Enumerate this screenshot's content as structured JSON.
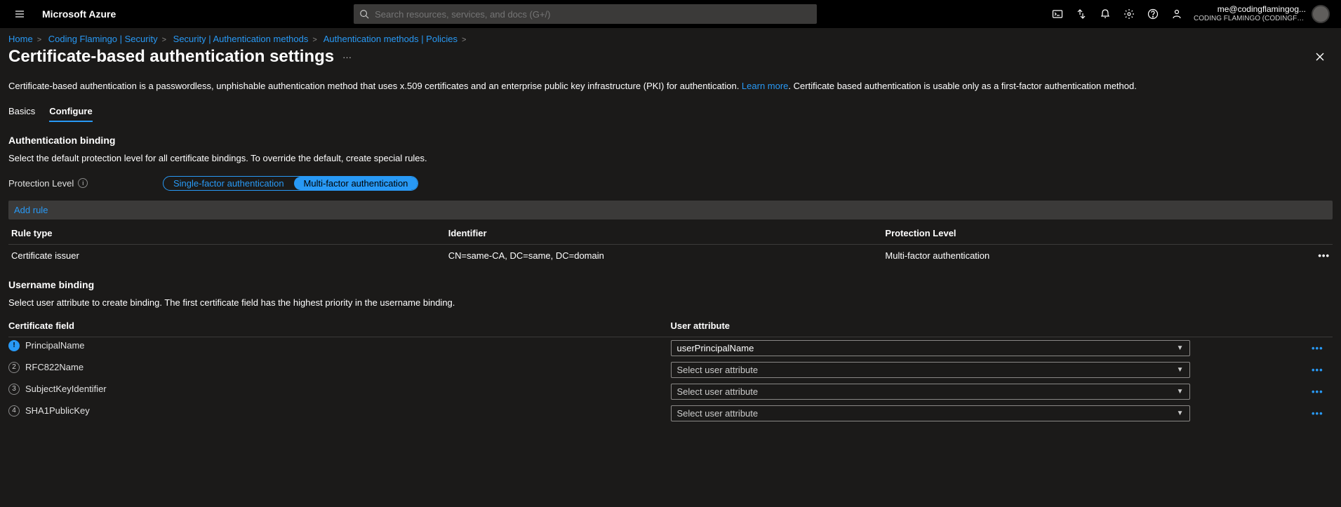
{
  "brand": "Microsoft Azure",
  "search_placeholder": "Search resources, services, and docs (G+/)",
  "user": {
    "email": "me@codingflamingog...",
    "tenant": "CODING FLAMINGO (CODINGFL..."
  },
  "breadcrumbs": [
    "Home",
    "Coding Flamingo | Security",
    "Security | Authentication methods",
    "Authentication methods | Policies"
  ],
  "page_title": "Certificate-based authentication settings",
  "description_a": "Certificate-based authentication is a passwordless, unphishable authentication method that uses x.509 certificates and an enterprise public key infrastructure (PKI) for authentication. ",
  "description_learn": "Learn more",
  "description_b": ". Certificate based authentication is usable only as a first-factor authentication method.",
  "tabs": {
    "basics": "Basics",
    "configure": "Configure"
  },
  "auth_binding": {
    "title": "Authentication binding",
    "desc": "Select the default protection level for all certificate bindings. To override the default, create special rules.",
    "protection_label": "Protection Level",
    "pill_single": "Single-factor authentication",
    "pill_multi": "Multi-factor authentication",
    "add_rule": "Add rule",
    "columns": {
      "ruletype": "Rule type",
      "identifier": "Identifier",
      "protection": "Protection Level"
    },
    "rows": [
      {
        "ruletype": "Certificate issuer",
        "identifier": "CN=same-CA, DC=same, DC=domain",
        "protection": "Multi-factor authentication"
      }
    ]
  },
  "user_binding": {
    "title": "Username binding",
    "desc": "Select user attribute to create binding. The first certificate field has the highest priority in the username binding.",
    "columns": {
      "certfield": "Certificate field",
      "userattr": "User attribute"
    },
    "placeholder": "Select user attribute",
    "rows": [
      {
        "ord": "1",
        "primary": true,
        "certfield": "PrincipalName",
        "userattr": "userPrincipalName"
      },
      {
        "ord": "2",
        "primary": false,
        "certfield": "RFC822Name",
        "userattr": ""
      },
      {
        "ord": "3",
        "primary": false,
        "certfield": "SubjectKeyIdentifier",
        "userattr": ""
      },
      {
        "ord": "4",
        "primary": false,
        "certfield": "SHA1PublicKey",
        "userattr": ""
      }
    ]
  }
}
